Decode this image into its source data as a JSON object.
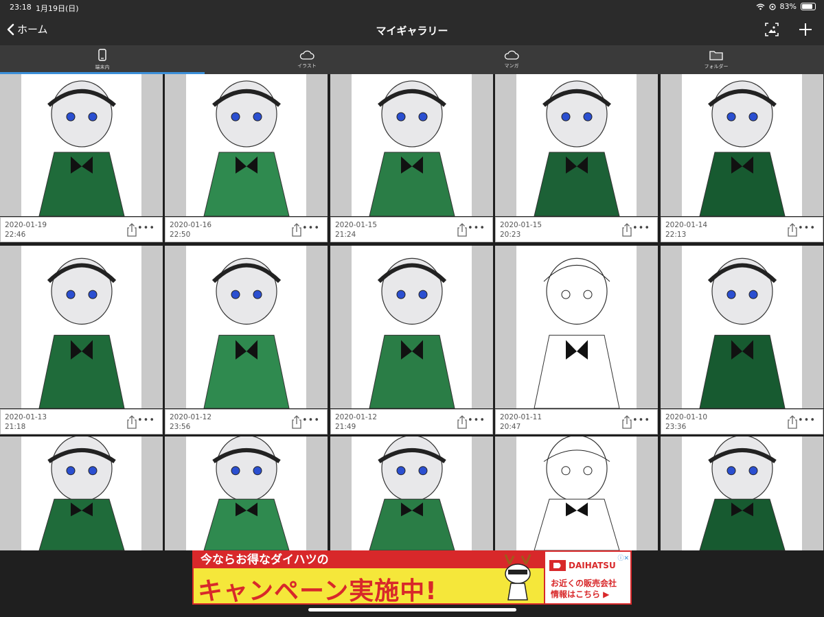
{
  "statusbar": {
    "time": "23:18",
    "date": "1月19日(日)",
    "battery": "83%"
  },
  "navbar": {
    "back_label": "ホーム",
    "title": "マイギャラリー"
  },
  "tabs": [
    {
      "label": "端末内",
      "icon": "device-icon"
    },
    {
      "label": "イラスト",
      "icon": "cloud-icon"
    },
    {
      "label": "マンガ",
      "icon": "cloud-icon"
    },
    {
      "label": "フォルダー",
      "icon": "folder-icon"
    }
  ],
  "gallery": [
    {
      "date": "2020-01-19",
      "time": "22:46"
    },
    {
      "date": "2020-01-16",
      "time": "22:50"
    },
    {
      "date": "2020-01-15",
      "time": "21:24"
    },
    {
      "date": "2020-01-15",
      "time": "20:23"
    },
    {
      "date": "2020-01-14",
      "time": "22:13"
    },
    {
      "date": "2020-01-13",
      "time": "21:18"
    },
    {
      "date": "2020-01-12",
      "time": "23:56"
    },
    {
      "date": "2020-01-12",
      "time": "21:49"
    },
    {
      "date": "2020-01-11",
      "time": "20:47"
    },
    {
      "date": "2020-01-10",
      "time": "23:36"
    },
    {
      "date": "",
      "time": ""
    },
    {
      "date": "",
      "time": ""
    },
    {
      "date": "",
      "time": ""
    },
    {
      "date": "",
      "time": ""
    },
    {
      "date": "",
      "time": ""
    }
  ],
  "ad": {
    "headline": "今ならお得なダイハツの",
    "main": "キャンペーン実施中!",
    "brand": "DAIHATSU",
    "sub1": "お近くの販売会社",
    "sub2": "情報はこちら ▶"
  }
}
